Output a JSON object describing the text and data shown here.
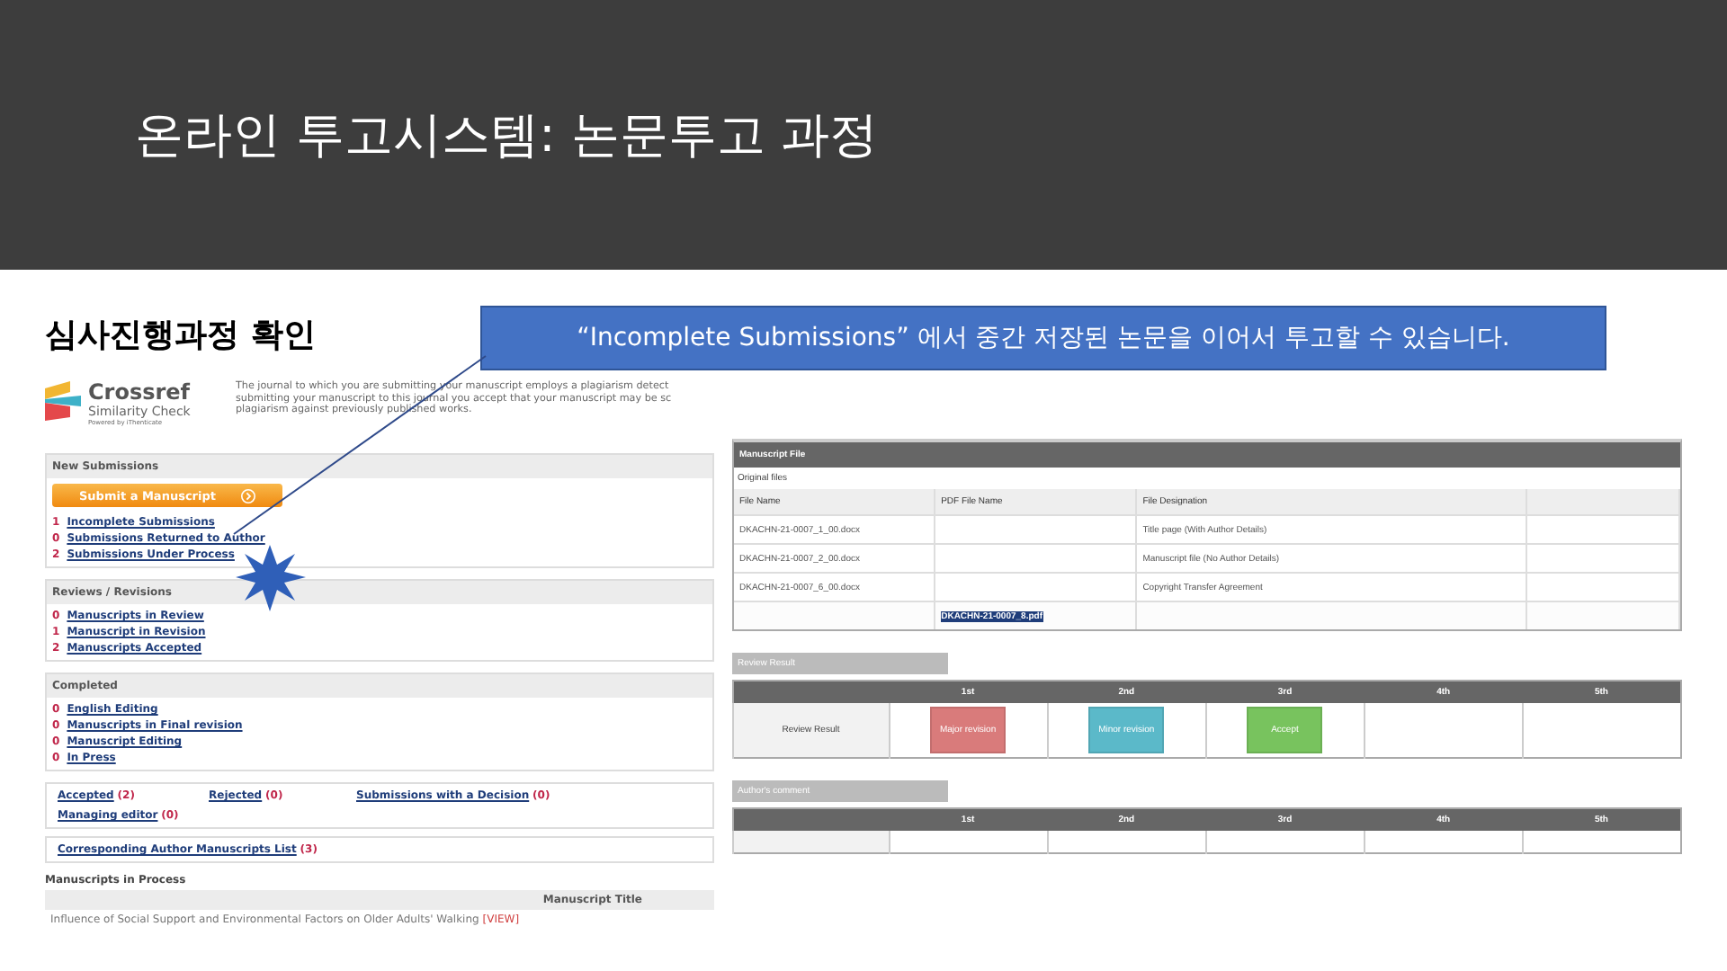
{
  "slide": {
    "title": "온라인 투고시스템: 논문투고 과정",
    "subtitle": "심사진행과정 확인",
    "callout": "“Incomplete Submissions” 에서 중간 저장된 논문을 이어서 투고할 수 있습니다."
  },
  "left_panel": {
    "logo": {
      "name": "Crossref",
      "tagline": "Similarity Check",
      "powered": "Powered by iThenticate"
    },
    "notice_lines": [
      "The journal to which you are submitting your manuscript employs a plagiarism detect",
      "submitting your manuscript to this journal you accept that your manuscript may be sc",
      "plagiarism against previously published works."
    ],
    "sections": [
      {
        "title": "New Submissions",
        "button": "Submit a Manuscript",
        "items": [
          {
            "count": "1",
            "label": "Incomplete Submissions"
          },
          {
            "count": "0",
            "label": "Submissions Returned to Author"
          },
          {
            "count": "2",
            "label": "Submissions Under Process"
          }
        ]
      },
      {
        "title": "Reviews / Revisions",
        "items": [
          {
            "count": "0",
            "label": "Manuscripts in Review"
          },
          {
            "count": "1",
            "label": "Manuscript in Revision"
          },
          {
            "count": "2",
            "label": "Manuscripts Accepted"
          }
        ]
      },
      {
        "title": "Completed",
        "items": [
          {
            "count": "0",
            "label": "English Editing"
          },
          {
            "count": "0",
            "label": "Manuscripts in Final revision"
          },
          {
            "count": "0",
            "label": "Manuscript Editing"
          },
          {
            "count": "0",
            "label": "In Press"
          }
        ]
      }
    ],
    "decisions": [
      {
        "label": "Accepted",
        "count": "(2)"
      },
      {
        "label": "Rejected",
        "count": "(0)"
      },
      {
        "label": "Submissions with a Decision",
        "count": "(0)"
      },
      {
        "label": "Managing editor",
        "count": "(0)"
      }
    ],
    "author_list": {
      "label": "Corresponding Author Manuscripts List",
      "count": "(3)"
    },
    "in_process": {
      "title": "Manuscripts in Process",
      "column": "Manuscript Title",
      "rows": [
        {
          "title": "Influence of Social Support and Environmental Factors on Older Adults' Walking",
          "action": "[VIEW]"
        }
      ]
    }
  },
  "right_panel": {
    "file_header": "Manuscript File",
    "files_caption": "Original files",
    "file_columns": [
      "File Name",
      "PDF File Name",
      "File Designation"
    ],
    "files": [
      {
        "name": "DKACHN-21-0007_1_00.docx",
        "designation": "Title page (With Author Details)",
        "selected": false
      },
      {
        "name": "DKACHN-21-0007_2_00.docx",
        "designation": "Manuscript file (No Author Details)",
        "selected": false
      },
      {
        "name": "DKACHN-21-0007_6_00.docx",
        "designation": "Copyright Transfer Agreement",
        "selected": false
      },
      {
        "pdf": "DKACHN-21-0007_8.pdf",
        "selected": true
      }
    ],
    "review_tab": "Review Result",
    "rounds": [
      "1st",
      "2nd",
      "3rd",
      "4th",
      "5th"
    ],
    "review_row_label": "Review Result",
    "results": [
      {
        "label": "Major revision",
        "color": "#d97b7b"
      },
      {
        "label": "Minor revision",
        "color": "#5bb9c9"
      },
      {
        "label": "Accept",
        "color": "#78c35e"
      }
    ],
    "comment_tab": "Author's comment",
    "comment_rounds": [
      "1st",
      "2nd",
      "3rd",
      "4th",
      "5th"
    ]
  }
}
